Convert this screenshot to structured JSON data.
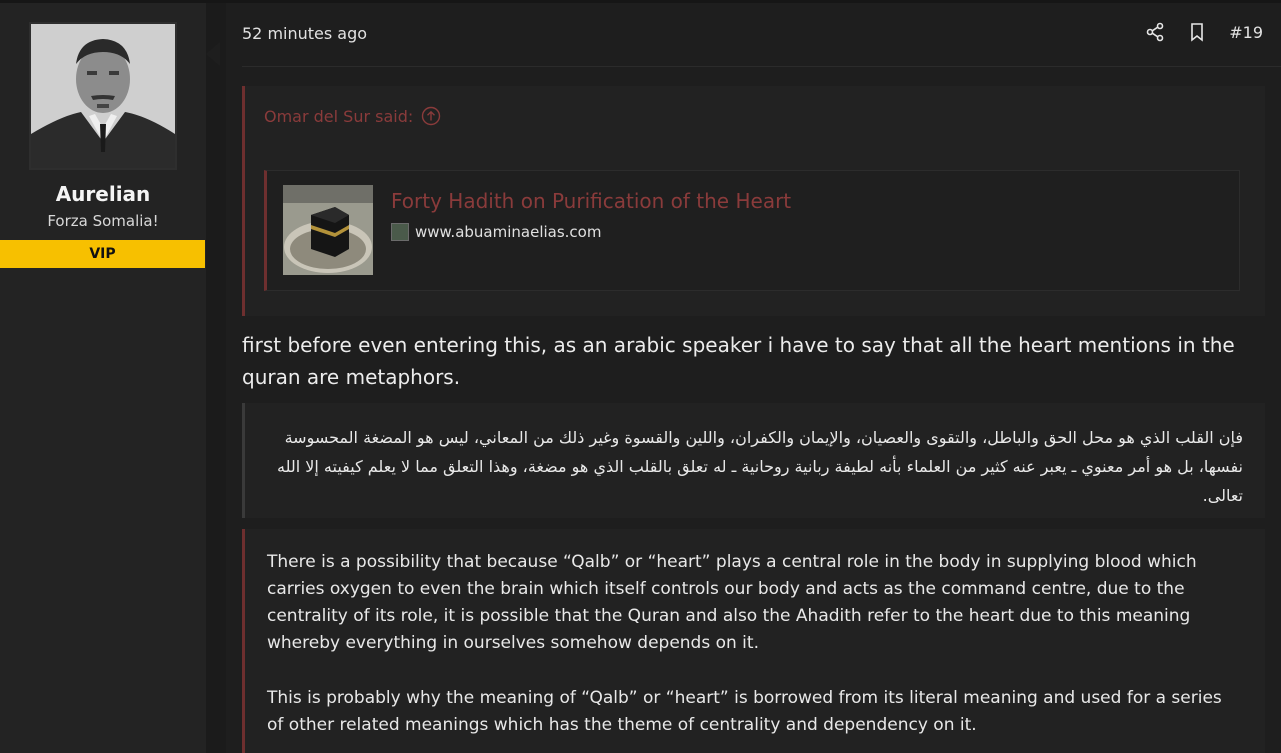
{
  "user": {
    "name": "Aurelian",
    "title": "Forza Somalia!",
    "badge": "VIP",
    "colors": {
      "badge": "#f7c000"
    }
  },
  "post": {
    "time": "52 minutes ago",
    "number": "#19",
    "icons": {
      "share": "share-icon",
      "bookmark": "bookmark-icon"
    }
  },
  "quote": {
    "author": "Omar del Sur said:",
    "embed": {
      "title": "Forty Hadith on Purification of the Heart",
      "site": "www.abuaminaelias.com"
    }
  },
  "body": {
    "intro": "first before even entering this, as an arabic speaker i have to say that all the heart mentions in the quran are metaphors.",
    "arabic": "فإن القلب الذي هو محل الحق والباطل، والتقوى والعصيان، والإيمان والكفران، واللين والقسوة وغير ذلك من المعاني، ليس هو المضغة المحسوسة نفسها، بل هو أمر معنوي ـ يعبر عنه كثير من العلماء بأنه لطيفة ربانية روحانية ـ له تعلق بالقلب الذي هو مضغة، وهذا التعلق مما لا يعلم كيفيته إلا الله تعالى.",
    "english_p1": "There is a possibility that because “Qalb” or “heart” plays a central role in the body in supplying blood which carries oxygen to even the brain which itself controls our body and acts as the command centre, due to the centrality of its role, it is possible that the Quran and also the Ahadith refer to the heart due to this meaning whereby everything in ourselves somehow depends on it.",
    "english_p2": "This is probably why the meaning of “Qalb” or “heart” is borrowed from its literal meaning and used for a series of other related meanings which has the theme of centrality and dependency on it."
  },
  "colors": {
    "accent": "#8a3b3b",
    "quote_border": "#6e2f2f"
  }
}
